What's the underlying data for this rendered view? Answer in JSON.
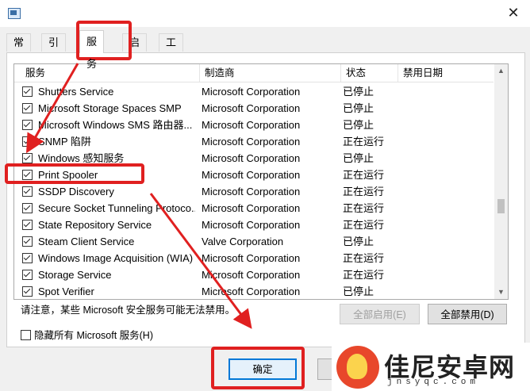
{
  "window": {
    "close_glyph": "✕"
  },
  "tabs": [
    "常规",
    "引导",
    "服务",
    "启动",
    "工具"
  ],
  "active_tab_index": 2,
  "columns": [
    "服务",
    "制造商",
    "状态",
    "禁用日期"
  ],
  "rows": [
    {
      "name": "Shutters Service",
      "manufacturer": "Microsoft Corporation",
      "status": "已停止",
      "checked": true
    },
    {
      "name": "Microsoft Storage Spaces SMP",
      "manufacturer": "Microsoft Corporation",
      "status": "已停止",
      "checked": true
    },
    {
      "name": "Microsoft Windows SMS 路由器...",
      "manufacturer": "Microsoft Corporation",
      "status": "已停止",
      "checked": true
    },
    {
      "name": "SNMP 陷阱",
      "manufacturer": "Microsoft Corporation",
      "status": "正在运行",
      "checked": true
    },
    {
      "name": "Windows 感知服务",
      "manufacturer": "Microsoft Corporation",
      "status": "已停止",
      "checked": true
    },
    {
      "name": "Print Spooler",
      "manufacturer": "Microsoft Corporation",
      "status": "正在运行",
      "checked": true
    },
    {
      "name": "SSDP Discovery",
      "manufacturer": "Microsoft Corporation",
      "status": "正在运行",
      "checked": true
    },
    {
      "name": "Secure Socket Tunneling Protoco...",
      "manufacturer": "Microsoft Corporation",
      "status": "正在运行",
      "checked": true
    },
    {
      "name": "State Repository Service",
      "manufacturer": "Microsoft Corporation",
      "status": "正在运行",
      "checked": true
    },
    {
      "name": "Steam Client Service",
      "manufacturer": "Valve Corporation",
      "status": "已停止",
      "checked": true
    },
    {
      "name": "Windows Image Acquisition (WIA)",
      "manufacturer": "Microsoft Corporation",
      "status": "正在运行",
      "checked": true
    },
    {
      "name": "Storage Service",
      "manufacturer": "Microsoft Corporation",
      "status": "正在运行",
      "checked": true
    },
    {
      "name": "Spot Verifier",
      "manufacturer": "Microsoft Corporation",
      "status": "已停止",
      "checked": true
    }
  ],
  "note": "请注意，某些 Microsoft 安全服务可能无法禁用。",
  "buttons": {
    "enable_all": "全部启用(E)",
    "disable_all": "全部禁用(D)",
    "ok": "确定"
  },
  "hide_ms_label": "隐藏所有 Microsoft 服务(H)",
  "hide_ms_checked": false,
  "watermark": {
    "title": "佳尼安卓网",
    "domain": "jnsyqc.com"
  },
  "annotation_color": "#e02020"
}
